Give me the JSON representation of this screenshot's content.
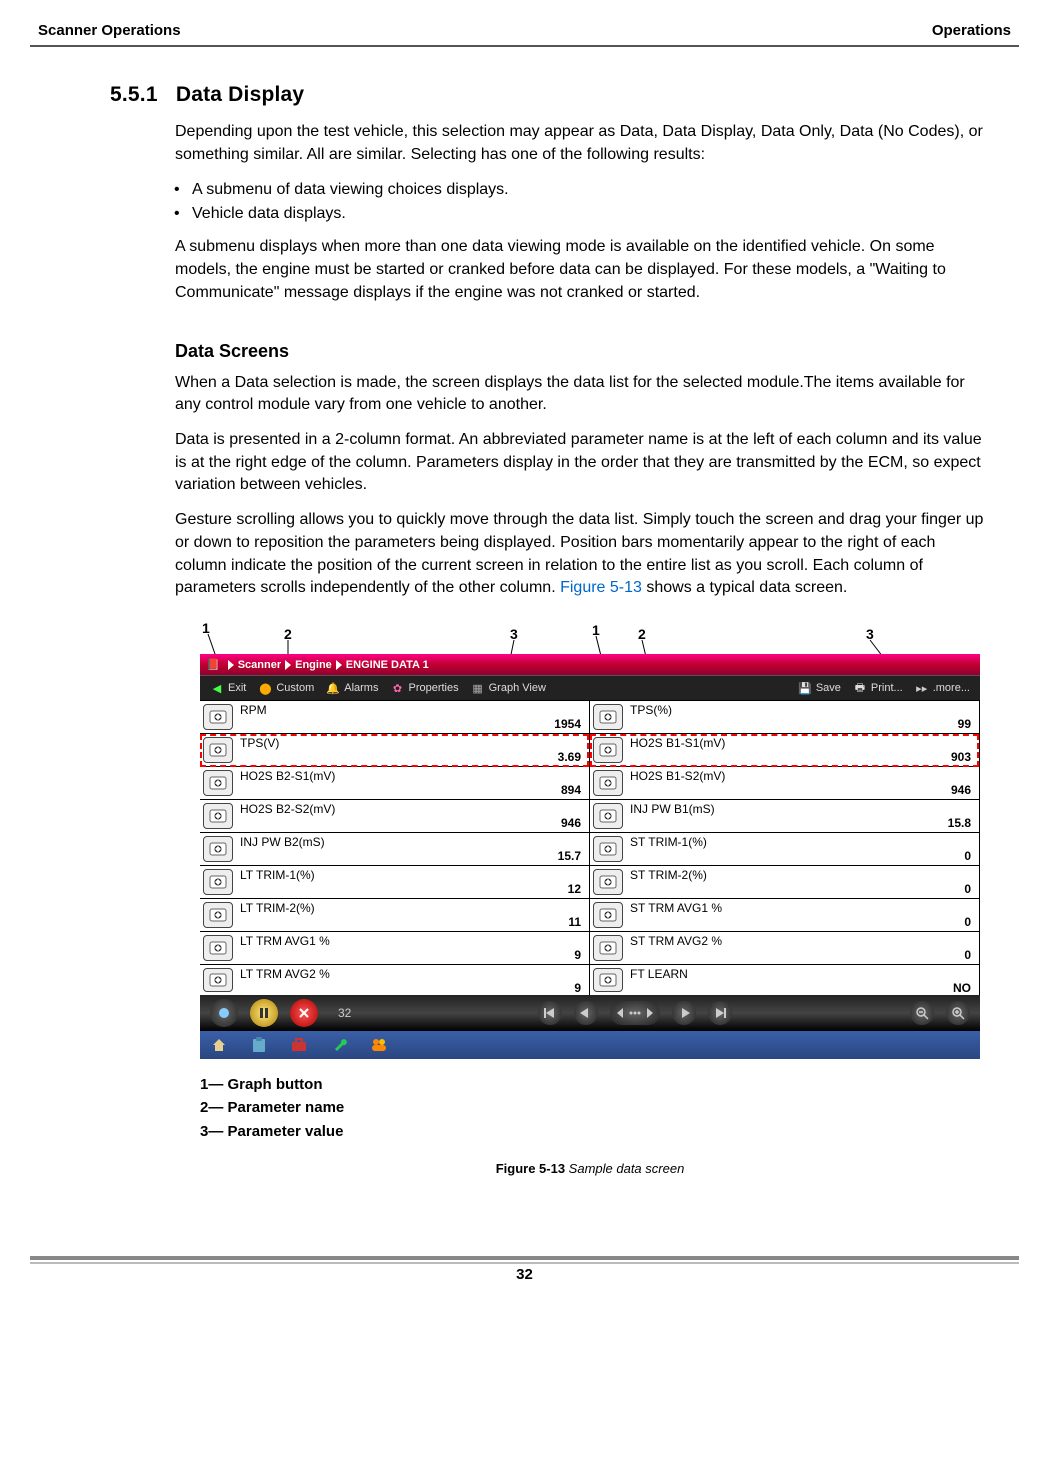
{
  "header": {
    "left": "Scanner Operations",
    "right": "Operations"
  },
  "section": {
    "number": "5.5.1",
    "title": "Data Display",
    "p1": "Depending upon the test vehicle, this selection may appear as Data, Data Display, Data Only, Data (No Codes), or something similar. All are similar. Selecting has one of the following results:",
    "bullets": [
      "A submenu of data viewing choices displays.",
      "Vehicle data displays."
    ],
    "p2": "A submenu displays when more than one data viewing mode is available on the identified vehicle. On some models, the engine must be started or cranked before data can be displayed. For these models, a \"Waiting to Communicate\" message displays if the engine was not cranked or started."
  },
  "subsection": {
    "title": "Data Screens",
    "p1": "When a Data selection is made, the screen displays the data list for the selected module.The items available for any control module vary from one vehicle to another.",
    "p2": "Data is presented in a 2-column format. An abbreviated parameter name is at the left of each column and its value is at the right edge of the column. Parameters display in the order that they are transmitted by the ECM, so expect variation between vehicles.",
    "p3_pre": "Gesture scrolling allows you to quickly move through the data list. Simply touch the screen and drag your finger up or down to reposition the parameters being displayed. Position bars momentarily appear to the right of each column indicate the position of the current screen in relation to the entire list as you scroll. Each column of parameters scrolls independently of the other column. ",
    "p3_link": "Figure 5-13",
    "p3_post": " shows a typical data screen."
  },
  "callouts": {
    "c1": "1",
    "c2": "2",
    "c3": "3"
  },
  "screenshot": {
    "breadcrumb": [
      "Scanner",
      "Engine",
      "ENGINE DATA 1"
    ],
    "toolbar": {
      "exit": "Exit",
      "custom": "Custom",
      "alarms": "Alarms",
      "properties": "Properties",
      "graphview": "Graph View",
      "save": "Save",
      "print": "Print...",
      "more": ".more..."
    },
    "left": [
      {
        "name": "RPM",
        "value": "1954"
      },
      {
        "name": "TPS(V)",
        "value": "3.69"
      },
      {
        "name": "HO2S B2-S1(mV)",
        "value": "894"
      },
      {
        "name": "HO2S B2-S2(mV)",
        "value": "946"
      },
      {
        "name": "INJ PW B2(mS)",
        "value": "15.7"
      },
      {
        "name": "LT TRIM-1(%)",
        "value": "12"
      },
      {
        "name": "LT TRIM-2(%)",
        "value": "11"
      },
      {
        "name": "LT TRM AVG1 %",
        "value": "9"
      },
      {
        "name": "LT TRM AVG2 %",
        "value": "9"
      }
    ],
    "right": [
      {
        "name": "TPS(%)",
        "value": "99"
      },
      {
        "name": "HO2S B1-S1(mV)",
        "value": "903"
      },
      {
        "name": "HO2S B1-S2(mV)",
        "value": "946"
      },
      {
        "name": "INJ PW B1(mS)",
        "value": "15.8"
      },
      {
        "name": "ST TRIM-1(%)",
        "value": "0"
      },
      {
        "name": "ST TRIM-2(%)",
        "value": "0"
      },
      {
        "name": "ST TRM AVG1 %",
        "value": "0"
      },
      {
        "name": "ST TRM AVG2 %",
        "value": "0"
      },
      {
        "name": "FT LEARN",
        "value": "NO"
      }
    ],
    "bottombar": {
      "counter": "32"
    }
  },
  "legend": {
    "l1": "1— Graph button",
    "l2": "2— Parameter name",
    "l3": "3— Parameter value"
  },
  "figure_caption": {
    "bold": "Figure 5-13",
    "italic": " Sample data screen"
  },
  "page_number": "32"
}
